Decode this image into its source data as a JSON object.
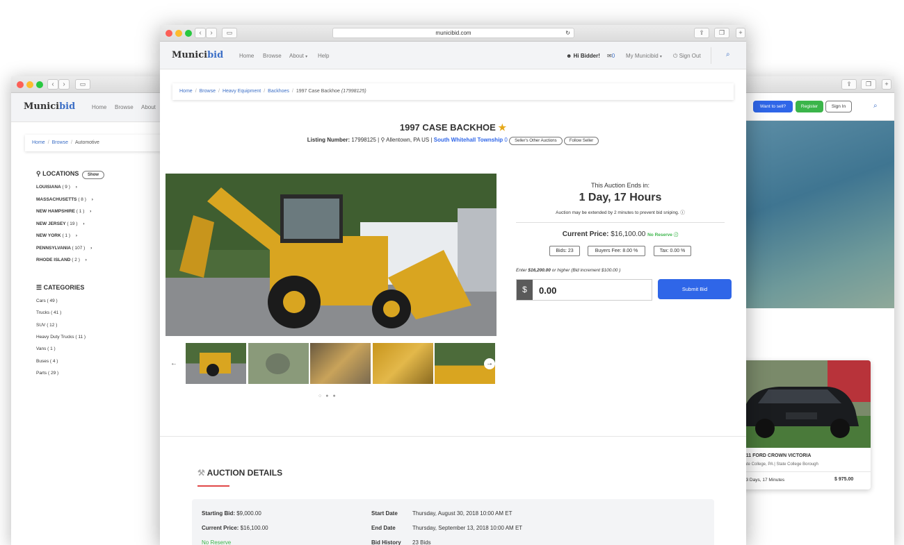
{
  "left_window": {
    "logo": {
      "a": "Munici",
      "b": "bid"
    },
    "nav": {
      "home": "Home",
      "browse": "Browse",
      "about": "About"
    },
    "breadcrumb": {
      "home": "Home",
      "browse": "Browse",
      "current": "Automotive"
    },
    "locations": {
      "title": "LOCATIONS",
      "show": "Show",
      "items": [
        {
          "name": "LOUISIANA",
          "count": "( 9 )"
        },
        {
          "name": "MASSACHUSETTS",
          "count": "( 8 )"
        },
        {
          "name": "NEW HAMPSHIRE",
          "count": "( 1 )"
        },
        {
          "name": "NEW JERSEY",
          "count": "( 19 )"
        },
        {
          "name": "NEW YORK",
          "count": "( 1 )"
        },
        {
          "name": "PENNSYLVANIA",
          "count": "( 107 )"
        },
        {
          "name": "RHODE ISLAND",
          "count": "( 2 )"
        }
      ]
    },
    "categories": {
      "title": "CATEGORIES",
      "items": [
        {
          "name": "Cars",
          "count": "( 49 )"
        },
        {
          "name": "Trucks",
          "count": "( 41 )"
        },
        {
          "name": "SUV",
          "count": "( 12 )"
        },
        {
          "name": "Heavy Duty Trucks",
          "count": "( 11 )"
        },
        {
          "name": "Vans",
          "count": "( 1 )"
        },
        {
          "name": "Buses",
          "count": "( 4 )"
        },
        {
          "name": "Parts",
          "count": "( 29 )"
        }
      ]
    }
  },
  "right_window": {
    "want_to_sell": "Want to sell?",
    "register": "Register",
    "sign_in": "Sign In",
    "card": {
      "title": "2011 FORD CROWN VICTORIA",
      "location": "State College, PA | State College Borough",
      "time_left": "3 Days, 17 Minutes",
      "price": "$ 975.00"
    }
  },
  "main_window": {
    "url": "municibid.com",
    "logo": {
      "a": "Munici",
      "b": "bid"
    },
    "nav": {
      "home": "Home",
      "browse": "Browse",
      "about": "About",
      "help": "Help"
    },
    "user": {
      "greeting": "Hi Bidder!",
      "messages": "0",
      "my": "My Municibid",
      "sign_out": "Sign Out"
    },
    "breadcrumb": {
      "home": "Home",
      "browse": "Browse",
      "category": "Heavy Equipment",
      "sub": "Backhoes",
      "current": "1997 Case Backhoe",
      "current_id": "(17998125)"
    },
    "listing": {
      "title": "1997 CASE BACKHOE",
      "number_label": "Listing Number:",
      "number": "17998125 |",
      "location": "Allentown, PA US |",
      "seller": "South Whitehall Township",
      "seller_count": "0",
      "other_auctions": "Seller's Other Auctions",
      "follow": "Follow Seller"
    },
    "auction": {
      "ends_label": "This Auction Ends in:",
      "ends_value": "1 Day, 17 Hours",
      "extend_note": "Auction may be extended by 2 minutes to prevent bid sniping.",
      "price_label": "Current Price:",
      "price": "$16,100.00",
      "reserve": "No Reserve",
      "bids": "Bids: 23",
      "buyers_fee": "Buyers Fee: 8.00 %",
      "tax": "Tax: 0.00 %",
      "enter_pre": "Enter",
      "enter_amount": "$16,200.00",
      "enter_post": "or higher",
      "increment": "(Bid increment $100.00 )",
      "currency": "$",
      "bid_value": "0.00",
      "submit": "Submit Bid"
    },
    "details": {
      "title": "AUCTION DETAILS",
      "starting_bid_label": "Starting Bid:",
      "starting_bid": "$9,000.00",
      "current_price_label": "Current Price:",
      "current_price": "$16,100.00",
      "no_reserve": "No Reserve",
      "start_date_label": "Start Date",
      "start_date": "Thursday, August 30, 2018 10:00 AM ET",
      "end_date_label": "End Date",
      "end_date": "Thursday, September 13, 2018 10:00 AM ET",
      "bid_history_label": "Bid History",
      "bid_history": "23 Bids"
    }
  }
}
